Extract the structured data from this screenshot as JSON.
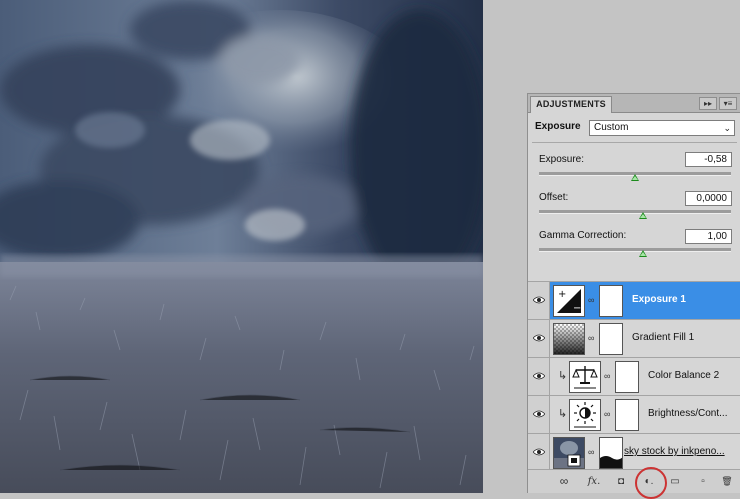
{
  "adjustments": {
    "tab_label": "ADJUSTMENTS",
    "collapse_glyph": "▸▸",
    "menu_glyph": "▾≡",
    "title": "Exposure",
    "preset": "Custom",
    "controls": [
      {
        "label": "Exposure:",
        "value": "-0,58",
        "slider_fraction": 0.5
      },
      {
        "label": "Offset:",
        "value": "0,0000",
        "slider_fraction": 0.54
      },
      {
        "label": "Gamma Correction:",
        "value": "1,00",
        "slider_fraction": 0.54
      }
    ]
  },
  "layers": {
    "rows": [
      {
        "name": "Exposure 1",
        "selected": true,
        "thumb_icon": "exposure-icon"
      },
      {
        "name": "Gradient Fill 1",
        "selected": false,
        "thumb_icon": "gradient-fill-icon"
      },
      {
        "name": "Color Balance 2",
        "selected": false,
        "thumb_icon": "color-balance-icon"
      },
      {
        "name": "Brightness/Cont...",
        "selected": false,
        "thumb_icon": "brightness-contrast-icon"
      },
      {
        "name": "sky stock by inkpeno...",
        "selected": false,
        "thumb_icon": "photo-thumbnail"
      }
    ],
    "toolbar": {
      "link": "∞",
      "fx": "fx.",
      "mask": "◘",
      "adjustment": "◐.",
      "group": "▭",
      "new": "▫",
      "trash": "🗑"
    }
  },
  "colors": {
    "selected_row": "#3a8ee6",
    "slider_thumb": "#1c8a1c",
    "highlight_circle": "#cc3333"
  }
}
